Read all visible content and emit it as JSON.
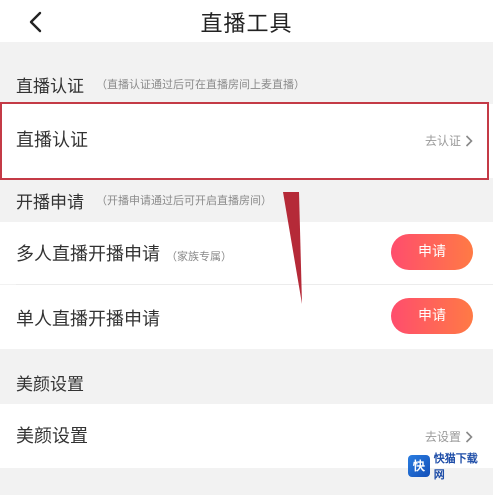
{
  "header": {
    "title": "直播工具",
    "back_icon": "chevron-left-icon"
  },
  "sections": {
    "live_verify": {
      "title": "直播认证",
      "hint": "（直播认证通过后可在直播房间上麦直播）",
      "row": {
        "label": "直播认证",
        "action": "去认证",
        "icon": "chevron-right-icon"
      }
    },
    "apply": {
      "title": "开播申请",
      "hint": "（开播申请通过后可开启直播房间）",
      "rows": [
        {
          "label": "多人直播开播申请",
          "sub": "（家族专属）",
          "button": "申请"
        },
        {
          "label": "单人直播开播申请",
          "button": "申请"
        }
      ]
    },
    "beauty": {
      "title": "美颜设置",
      "row": {
        "label": "美颜设置",
        "action": "去设置",
        "icon": "chevron-right-icon"
      }
    }
  },
  "colors": {
    "highlight": "#c43a46",
    "button_start": "#ff4d6d",
    "button_end": "#ff7a45"
  },
  "watermark": {
    "logo_text": "快",
    "text": "快猫下载网"
  }
}
